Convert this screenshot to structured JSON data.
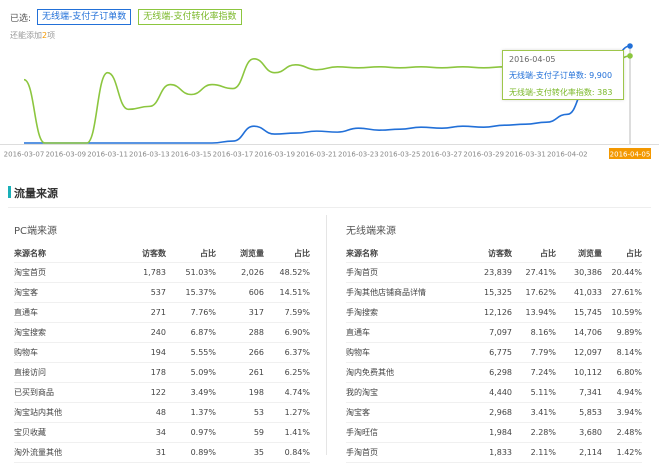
{
  "selector": {
    "label": "已选:",
    "tags": [
      "无线端-支付子订单数",
      "无线端-支付转化率指数"
    ],
    "hint_prefix": "还能添加",
    "hint_count": "2",
    "hint_suffix": "项"
  },
  "colors": {
    "blue": "#2270d8",
    "green": "#8cc63f",
    "highlight": "#f39800"
  },
  "chart_data": {
    "type": "line",
    "x": [
      "2016-03-07",
      "2016-03-08",
      "2016-03-09",
      "2016-03-10",
      "2016-03-11",
      "2016-03-12",
      "2016-03-13",
      "2016-03-14",
      "2016-03-15",
      "2016-03-16",
      "2016-03-17",
      "2016-03-18",
      "2016-03-19",
      "2016-03-20",
      "2016-03-21",
      "2016-03-22",
      "2016-03-23",
      "2016-03-24",
      "2016-03-25",
      "2016-03-26",
      "2016-03-27",
      "2016-03-28",
      "2016-03-29",
      "2016-03-30",
      "2016-03-31",
      "2016-04-01",
      "2016-04-02",
      "2016-04-03",
      "2016-04-04",
      "2016-04-05"
    ],
    "tick_labels": [
      "2016-03-07",
      "2016-03-09",
      "2016-03-11",
      "2016-03-13",
      "2016-03-15",
      "2016-03-17",
      "2016-03-19",
      "2016-03-21",
      "2016-03-23",
      "2016-03-25",
      "2016-03-27",
      "2016-03-29",
      "2016-03-31",
      "2016-04-02",
      "2016-04-05"
    ],
    "highlight_x": "2016-04-05",
    "series": [
      {
        "name": "无线端-支付子订单数",
        "color": "#2270d8",
        "norm": [
          0.01,
          0.01,
          0.01,
          0.01,
          0.01,
          0.01,
          0.01,
          0.01,
          0.01,
          0.01,
          0.03,
          0.18,
          0.1,
          0.11,
          0.13,
          0.12,
          0.16,
          0.14,
          0.15,
          0.17,
          0.16,
          0.18,
          0.17,
          0.19,
          0.2,
          0.22,
          0.3,
          0.6,
          0.8,
          0.99
        ]
      },
      {
        "name": "无线端-支付转化率指数",
        "color": "#8cc63f",
        "norm": [
          0.65,
          0.01,
          0.01,
          0.01,
          0.72,
          0.35,
          0.38,
          0.6,
          0.5,
          0.6,
          0.56,
          0.86,
          0.72,
          0.8,
          0.75,
          0.78,
          0.77,
          0.78,
          0.77,
          0.78,
          0.77,
          0.78,
          0.77,
          0.78,
          0.76,
          0.77,
          0.76,
          0.77,
          0.78,
          0.89
        ]
      }
    ]
  },
  "tooltip": {
    "date": "2016-04-05",
    "line1_label": "无线端-支付子订单数:",
    "line1_value": "9,900",
    "line2_label": "无线端-支付转化率指数:",
    "line2_value": "383"
  },
  "section": {
    "title": "流量来源"
  },
  "pc": {
    "title": "PC端来源",
    "headers": [
      "来源名称",
      "访客数",
      "占比",
      "浏览量",
      "占比"
    ],
    "rows": [
      [
        "淘宝首页",
        "1,783",
        "51.03%",
        "2,026",
        "48.52%"
      ],
      [
        "淘宝客",
        "537",
        "15.37%",
        "606",
        "14.51%"
      ],
      [
        "直通车",
        "271",
        "7.76%",
        "317",
        "7.59%"
      ],
      [
        "淘宝搜索",
        "240",
        "6.87%",
        "288",
        "6.90%"
      ],
      [
        "购物车",
        "194",
        "5.55%",
        "266",
        "6.37%"
      ],
      [
        "直接访问",
        "178",
        "5.09%",
        "261",
        "6.25%"
      ],
      [
        "已买到商品",
        "122",
        "3.49%",
        "198",
        "4.74%"
      ],
      [
        "淘宝站内其他",
        "48",
        "1.37%",
        "53",
        "1.27%"
      ],
      [
        "宝贝收藏",
        "34",
        "0.97%",
        "59",
        "1.41%"
      ],
      [
        "淘外流量其他",
        "31",
        "0.89%",
        "35",
        "0.84%"
      ]
    ]
  },
  "mobile": {
    "title": "无线端来源",
    "headers": [
      "来源名称",
      "访客数",
      "占比",
      "浏览量",
      "占比"
    ],
    "rows": [
      [
        "手淘首页",
        "23,839",
        "27.41%",
        "30,386",
        "20.44%"
      ],
      [
        "手淘其他店铺商品详情",
        "15,325",
        "17.62%",
        "41,033",
        "27.61%"
      ],
      [
        "手淘搜索",
        "12,126",
        "13.94%",
        "15,745",
        "10.59%"
      ],
      [
        "直通车",
        "7,097",
        "8.16%",
        "14,706",
        "9.89%"
      ],
      [
        "购物车",
        "6,775",
        "7.79%",
        "12,097",
        "8.14%"
      ],
      [
        "淘内免费其他",
        "6,298",
        "7.24%",
        "10,112",
        "6.80%"
      ],
      [
        "我的淘宝",
        "4,440",
        "5.11%",
        "7,341",
        "4.94%"
      ],
      [
        "淘宝客",
        "2,968",
        "3.41%",
        "5,853",
        "3.94%"
      ],
      [
        "手淘旺信",
        "1,984",
        "2.28%",
        "3,680",
        "2.48%"
      ],
      [
        "手淘首页",
        "1,833",
        "2.11%",
        "2,114",
        "1.42%"
      ]
    ]
  }
}
